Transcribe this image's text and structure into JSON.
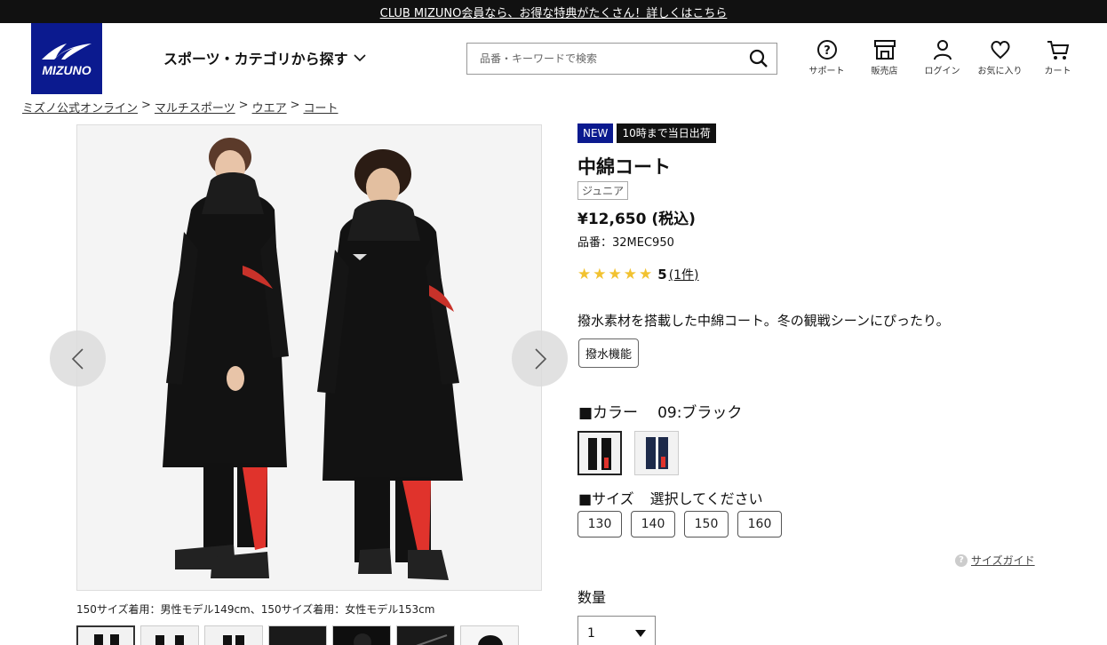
{
  "promo_bar": {
    "text": "CLUB MIZUNO会員なら、お得な特典がたくさん！詳しくはこちら"
  },
  "header": {
    "logo_text": "MIZUNO",
    "category_nav": "スポーツ・カテゴリから探す",
    "search": {
      "placeholder": "品番・キーワードで検索",
      "value": ""
    },
    "icons": [
      {
        "label": "サポート",
        "icon": "help-circle-icon"
      },
      {
        "label": "販売店",
        "icon": "store-icon"
      },
      {
        "label": "ログイン",
        "icon": "user-icon"
      },
      {
        "label": "お気に入り",
        "icon": "heart-icon"
      },
      {
        "label": "カート",
        "icon": "cart-icon"
      }
    ]
  },
  "breadcrumb": [
    "ミズノ公式オンライン",
    "マルチスポーツ",
    "ウエア",
    "コート"
  ],
  "gallery": {
    "caption": "150サイズ着用：男性モデル149cm、150サイズ着用：女性モデル153cm",
    "prev_icon": "chevron-left-icon",
    "next_icon": "chevron-right-icon",
    "thumbnail_count": 7
  },
  "product": {
    "badge_new": "NEW",
    "badge_shipping": "10時まで当日出荷",
    "title": "中綿コート",
    "tag": "ジュニア",
    "price": "¥12,650 (税込)",
    "part_number": "品番：32MEC950",
    "rating": {
      "stars": 5,
      "score": "5",
      "count_link": "(1件)"
    },
    "description": "撥水素材を搭載した中綿コート。冬の観戦シーンにぴったり。",
    "feature_tag": "撥水機能",
    "color_label": "■カラー",
    "color_value": "09:ブラック",
    "swatches": [
      {
        "name": "black"
      },
      {
        "name": "navy"
      }
    ],
    "size_label": "■サイズ",
    "size_prompt": "選択してください",
    "sizes": [
      "130",
      "140",
      "150",
      "160"
    ],
    "size_guide": "サイズガイド",
    "quantity_label": "数量",
    "quantity_value": "1"
  },
  "colors": {
    "brand_navy": "#0b1a8f",
    "accent_red": "#e0332c",
    "star": "#f2c230"
  }
}
